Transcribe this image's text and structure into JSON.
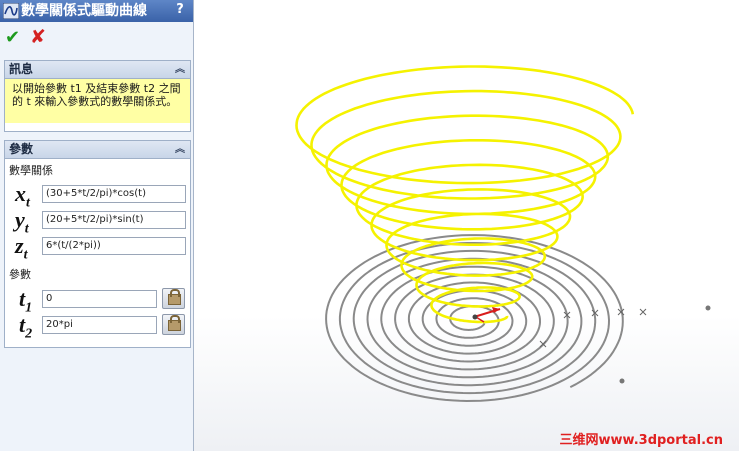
{
  "panel": {
    "title": "數學關係式驅動曲線",
    "help_label": "?",
    "ok_icon": "checkmark-icon",
    "cancel_icon": "x-icon",
    "message_group": {
      "title": "訊息",
      "text": "以開始參數 t1 及結束參數 t2 之間的 t 來輸入參數式的數學關係式。"
    },
    "params_group": {
      "title": "參數",
      "equations_label": "數學關係",
      "x_var": "x",
      "x_sub": "t",
      "x_value": "(30+5*t/2/pi)*cos(t)",
      "y_var": "y",
      "y_sub": "t",
      "y_value": "(20+5*t/2/pi)*sin(t)",
      "z_var": "z",
      "z_sub": "t",
      "z_value": "6*(t/(2*pi))",
      "params_label": "參數",
      "t1_var": "t",
      "t1_sub": "1",
      "t1_value": "0",
      "t2_var": "t",
      "t2_sub": "2",
      "t2_value": "20*pi"
    }
  },
  "watermark": "三维网www.3dportal.cn",
  "colors": {
    "helix": "#f5f200",
    "flat_spiral": "#8a8a8a",
    "title_bar": "#3f68ad",
    "message_bg": "#ffffa4",
    "watermark": "#e02020"
  }
}
